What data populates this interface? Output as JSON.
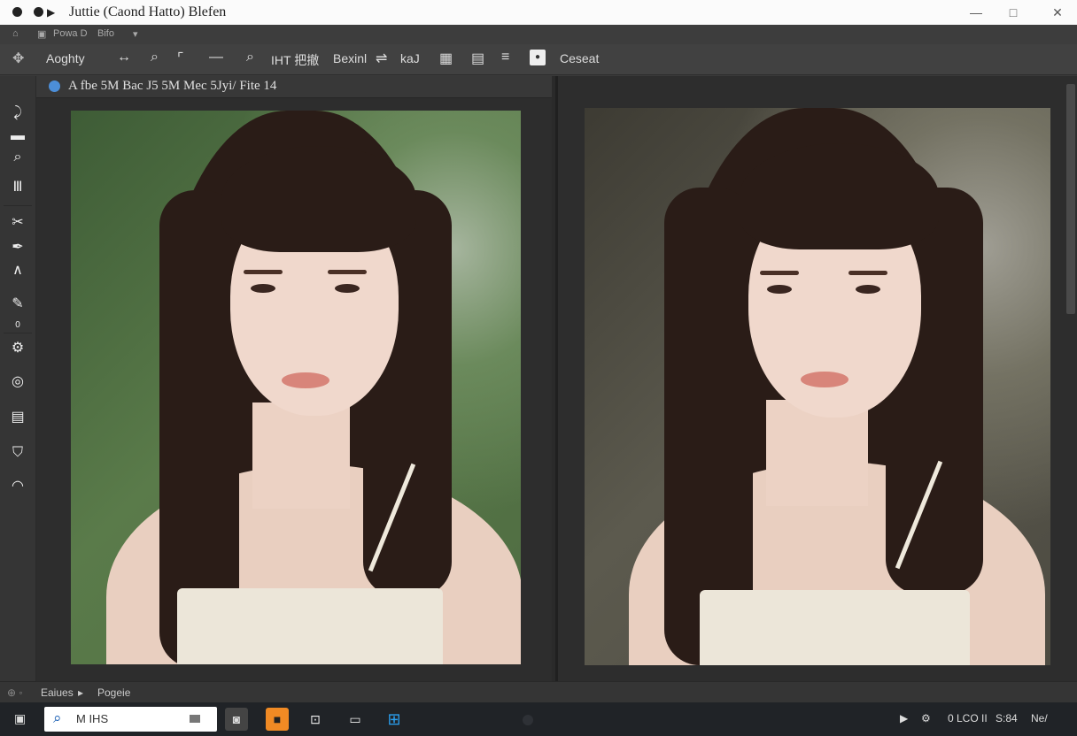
{
  "window": {
    "title": "Juttie (Caond Hatto) Blefen",
    "minimize_symbol": "—",
    "maximize_symbol": "□",
    "close_symbol": "✕"
  },
  "menu": {
    "items": [
      "Powa D",
      "Bifo"
    ]
  },
  "options_bar": {
    "preset": "Aoghty",
    "label_1": "IHT 把撤",
    "label_2": "Bexinl",
    "label_3": "kaJ",
    "dropdown": "Ceseat"
  },
  "document_tab": {
    "title": "A fbe 5M Bac J5 5M Mec 5Jyi/ Fite 14"
  },
  "tools": {
    "count_label": "0"
  },
  "status": {
    "left": "Eaiues",
    "arrow": "▸",
    "right": "Pogeie"
  },
  "taskbar": {
    "search_text": "M IHS",
    "tray_time": "0 LCO II",
    "tray_date": "S:84",
    "tray_extra": "Ne/"
  },
  "colors": {
    "accent": "#4c8ed8",
    "taskbar_search_icon": "#1a5fb4",
    "app_orange": "#f08a24",
    "app_blue": "#2aa0f0"
  },
  "icons": [
    "move-icon",
    "crop-icon",
    "zoom-icon",
    "brush-icon",
    "scissors-icon",
    "pen-icon",
    "eraser-icon",
    "gear-icon",
    "search-icon"
  ]
}
